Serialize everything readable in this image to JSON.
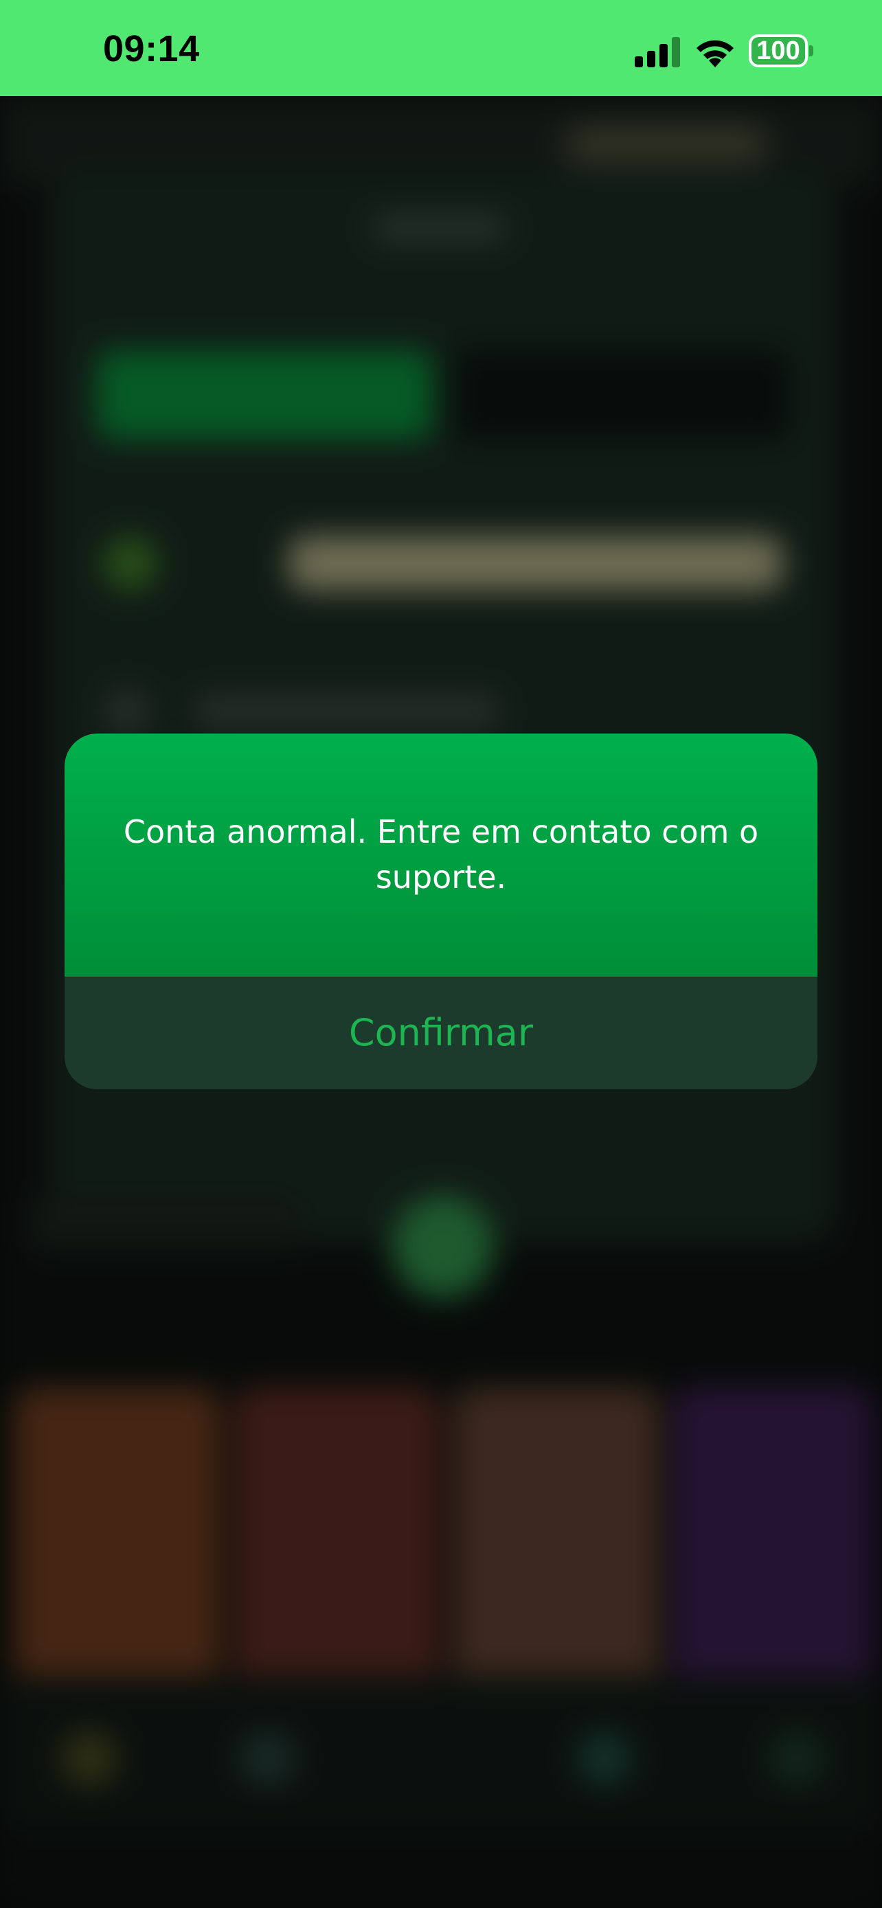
{
  "status_bar": {
    "time": "09:14",
    "battery_level": "100",
    "icons": [
      "cellular-signal-icon",
      "wifi-icon",
      "battery-icon"
    ],
    "background_color": "#50e870"
  },
  "dialog": {
    "message": "Conta anormal. Entre em contato com o suporte.",
    "confirm_label": "Confirmar",
    "accent_color": "#00b04c",
    "button_text_color": "#1cb552"
  }
}
